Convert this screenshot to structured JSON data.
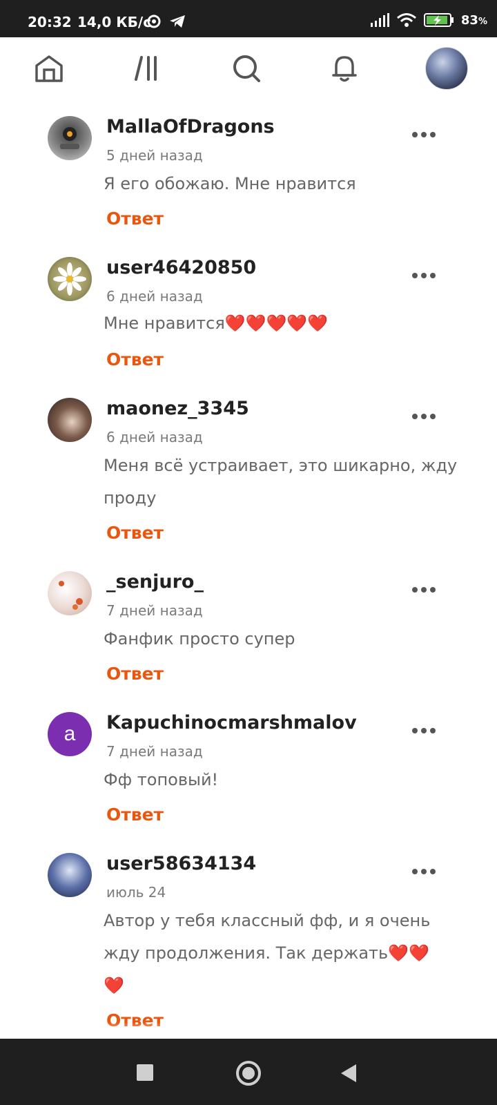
{
  "status_bar": {
    "time": "20:32",
    "speed": "14,0 КБ/с",
    "battery": "83",
    "battery_unit": "%"
  },
  "nav": {
    "icons": [
      "home-icon",
      "library-icon",
      "search-icon",
      "bell-icon",
      "profile-avatar"
    ]
  },
  "comments": [
    {
      "username": "MallaOfDragons",
      "time": "5 дней назад",
      "text": "Я его обожаю. Мне нравится",
      "reply": "Ответ"
    },
    {
      "username": "user46420850",
      "time": "6 дней назад",
      "text": "Мне нравится❤️❤️❤️❤️❤️",
      "reply": "Ответ"
    },
    {
      "username": "maonez_3345",
      "time": "6 дней назад",
      "text": "Меня всё устраивает, это шикарно, жду проду",
      "reply": "Ответ"
    },
    {
      "username": "_senjuro_",
      "time": "7 дней назад",
      "text": "Фанфик просто супер",
      "reply": "Ответ"
    },
    {
      "username": "Kapuchinocmarshmalov",
      "avatar_letter": "a",
      "time": "7 дней назад",
      "text": "Фф топовый!",
      "reply": "Ответ"
    },
    {
      "username": "user58634134",
      "time": "июль 24",
      "text": "Автор у тебя классный фф, и я очень жду продолжения. Так держать❤️❤️❤️",
      "reply": "Ответ"
    }
  ],
  "colors": {
    "accent": "#e9560e",
    "status_bar": "#1f1f1f",
    "letter_avatar": "#7b2fb0"
  }
}
